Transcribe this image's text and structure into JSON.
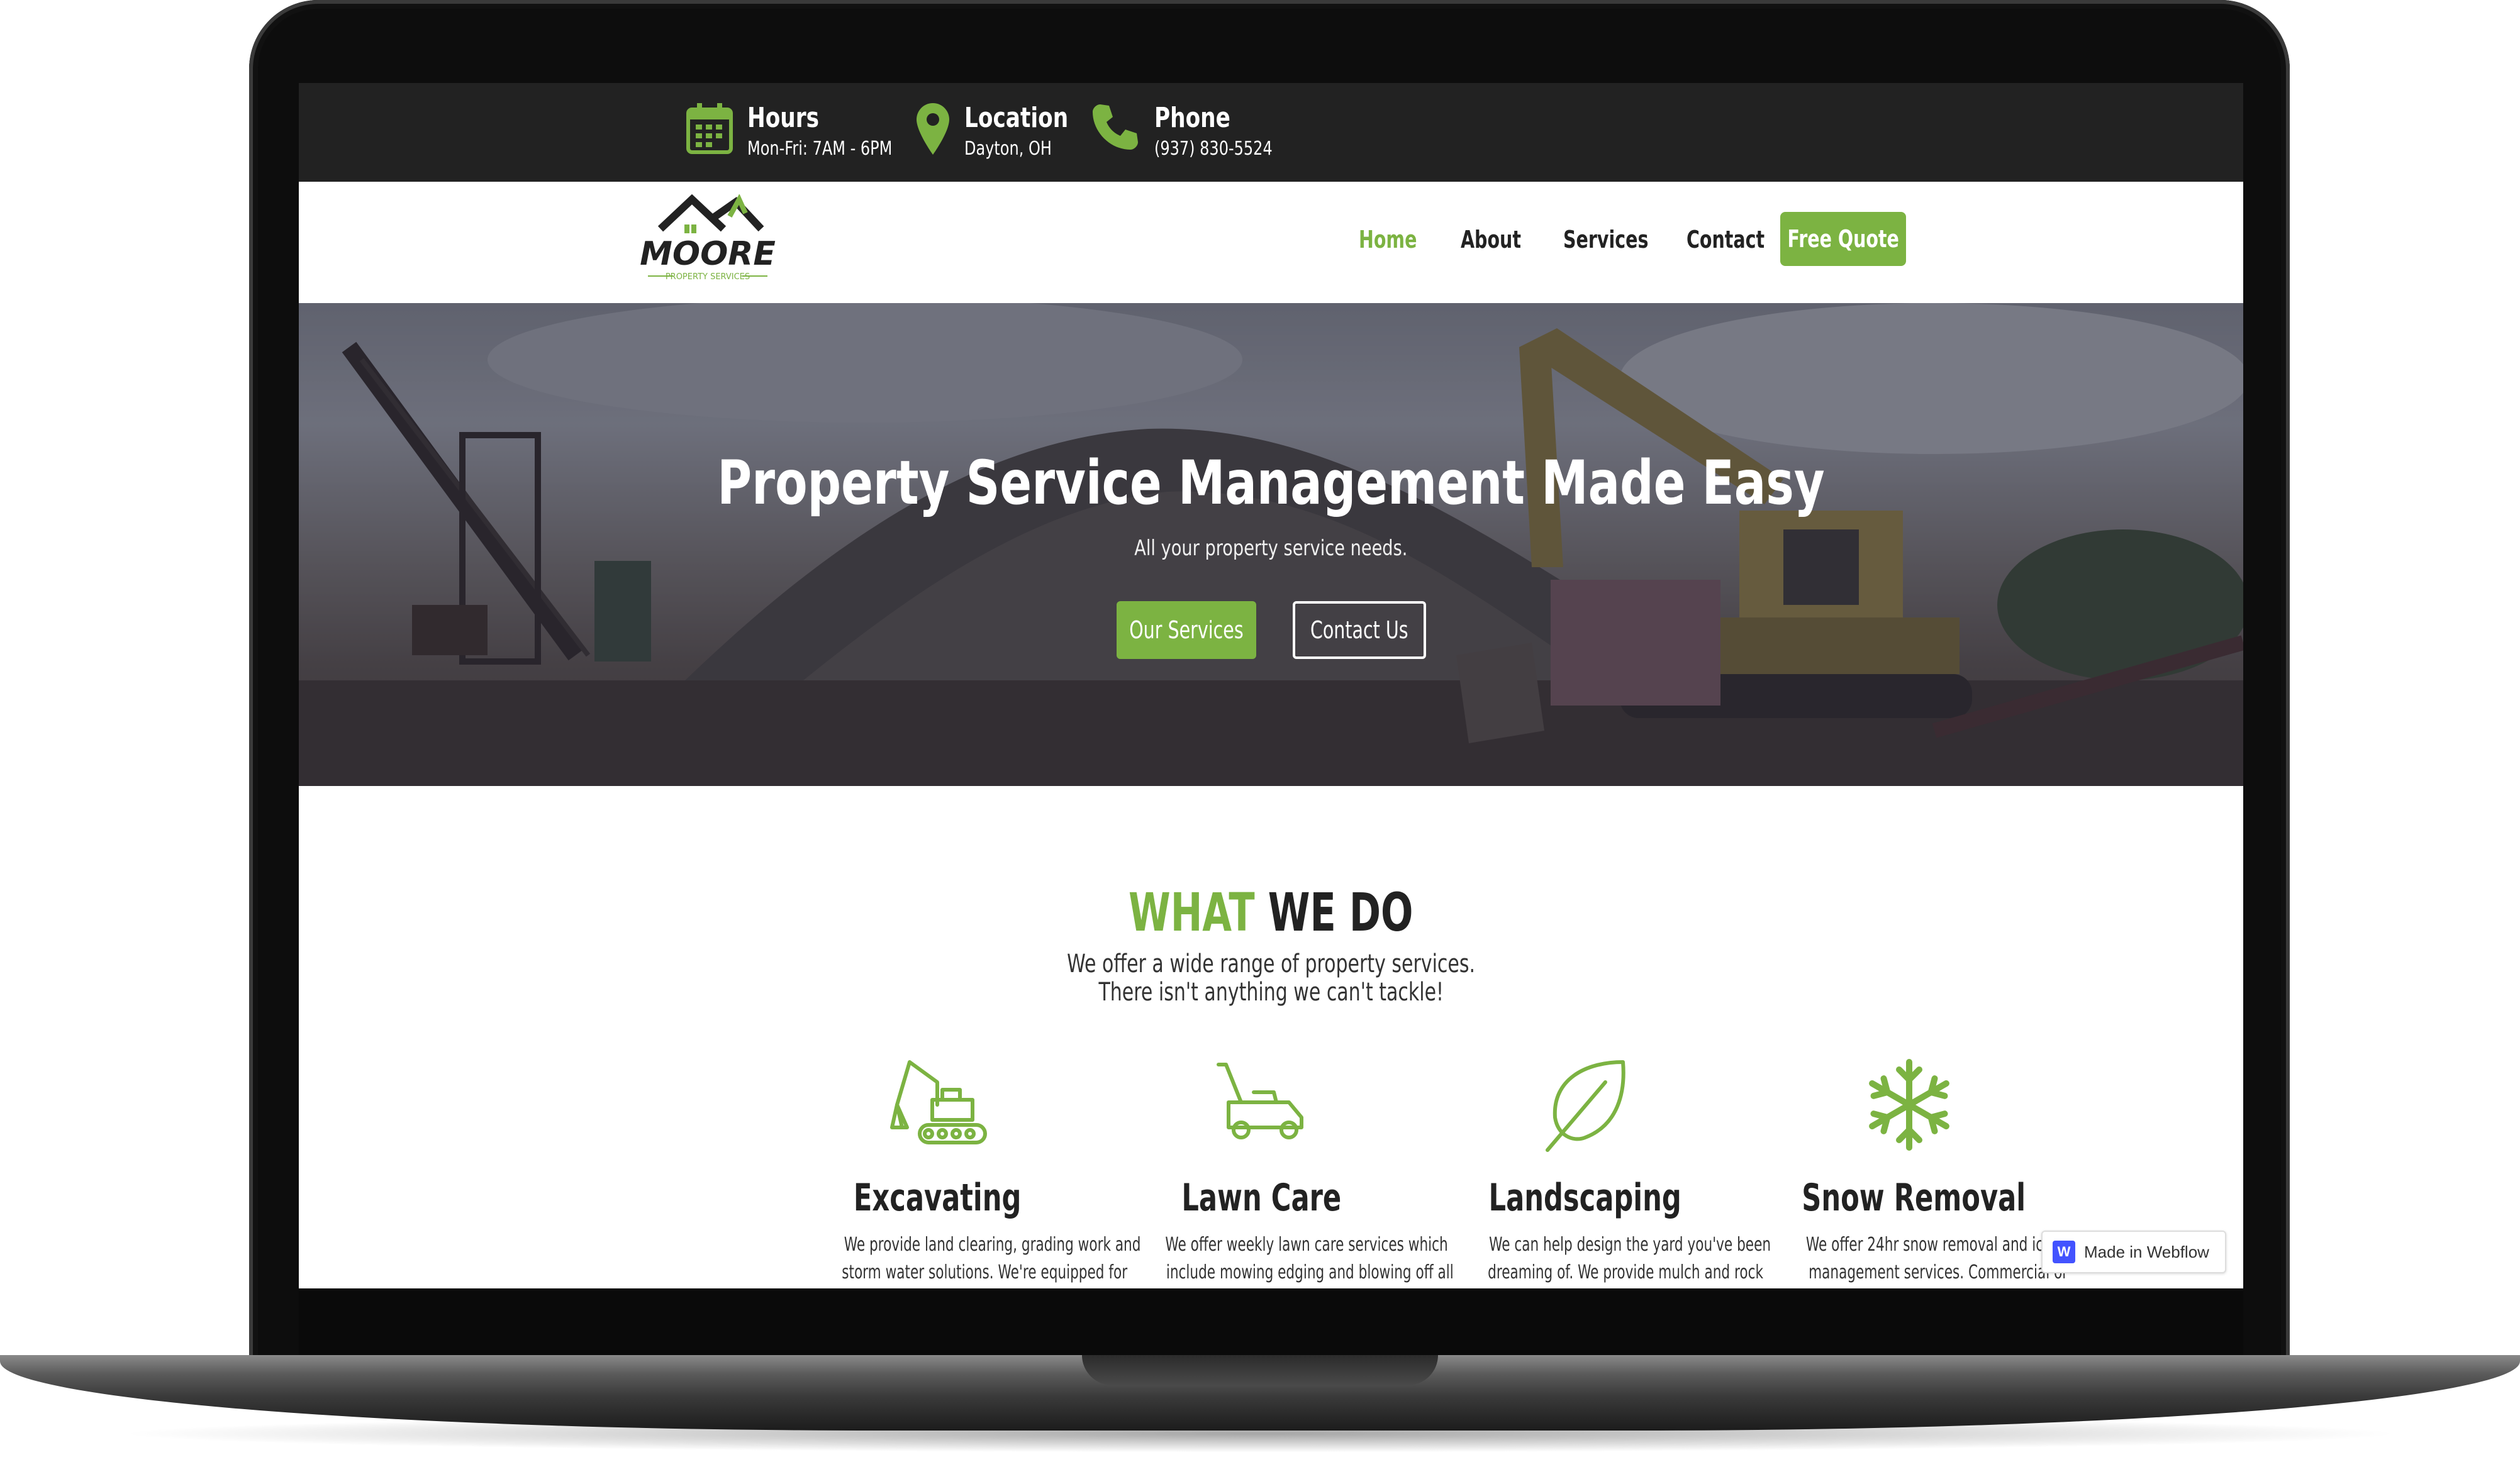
{
  "topbar": {
    "hours_label": "Hours",
    "hours_value": "Mon-Fri: 7AM - 6PM",
    "location_label": "Location",
    "location_value": "Dayton, OH",
    "phone_label": "Phone",
    "phone_value": "(937) 830-5524"
  },
  "logo": {
    "name": "MOORE",
    "tagline": "PROPERTY SERVICES"
  },
  "nav": {
    "items": [
      {
        "label": "Home",
        "active": true
      },
      {
        "label": "About",
        "active": false
      },
      {
        "label": "Services",
        "active": false
      },
      {
        "label": "Contact",
        "active": false
      }
    ],
    "cta": "Free Quote"
  },
  "hero": {
    "title": "Property Service Management Made Easy",
    "subtitle": "All your property service needs.",
    "primary_button": "Our Services",
    "secondary_button": "Contact Us"
  },
  "what_we_do": {
    "title_accent": "WHAT",
    "title_rest": "WE DO",
    "line1": "We offer a wide range of property services.",
    "line2": "There isn't anything we can't tackle!"
  },
  "services": [
    {
      "title": "Excavating",
      "icon": "excavator-icon",
      "line1": "We provide land clearing, grading work and",
      "line2": "storm water solutions. We're equipped for"
    },
    {
      "title": "Lawn Care",
      "icon": "lawn-mower-icon",
      "line1": "We offer weekly lawn care services which",
      "line2": "include mowing edging and blowing off all"
    },
    {
      "title": "Landscaping",
      "icon": "leaf-icon",
      "line1": "We can help design the yard you've been",
      "line2": "dreaming of. We provide mulch and rock"
    },
    {
      "title": "Snow Removal",
      "icon": "snowflake-icon",
      "line1": "We offer 24hr snow removal and ice",
      "line2": "management services. Commercial or"
    }
  ],
  "badge": {
    "text": "Made in Webflow",
    "logo_letter": "W"
  },
  "colors": {
    "accent": "#7cb342",
    "topbar": "#222222",
    "text": "#222222"
  }
}
